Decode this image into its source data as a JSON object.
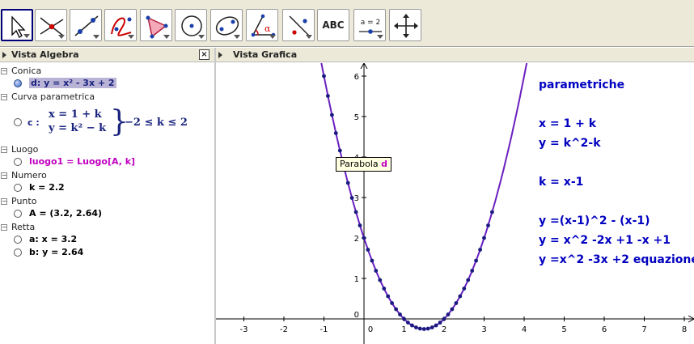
{
  "toolbar": {
    "tools": [
      {
        "name": "move-tool",
        "icon": "pointer-arrow-icon",
        "selected": true
      },
      {
        "name": "point-tool",
        "icon": "point-intersection-icon"
      },
      {
        "name": "line-tool",
        "icon": "line-through-points-icon"
      },
      {
        "name": "curve-tool",
        "icon": "curve-icon"
      },
      {
        "name": "polygon-tool",
        "icon": "polygon-icon"
      },
      {
        "name": "circle-tool",
        "icon": "circle-center-point-icon"
      },
      {
        "name": "conic-tool",
        "icon": "ellipse-icon"
      },
      {
        "name": "angle-tool",
        "icon": "angle-icon"
      },
      {
        "name": "reflect-tool",
        "icon": "reflect-line-icon"
      },
      {
        "name": "text-tool",
        "icon": "text-icon",
        "label": "ABC"
      },
      {
        "name": "slider-tool",
        "icon": "slider-icon",
        "label": "a = 2"
      },
      {
        "name": "move-view-tool",
        "icon": "move-view-icon"
      }
    ]
  },
  "algebra": {
    "title": "Vista Algebra",
    "close_label": "×",
    "categories": {
      "conica": "Conica",
      "curva": "Curva parametrica",
      "luogo": "Luogo",
      "numero": "Numero",
      "punto": "Punto",
      "retta": "Retta"
    },
    "items": {
      "d": "d: y = x² - 3x + 2",
      "c_label": "c :",
      "c_eq1": "x = 1 + k",
      "c_eq2": "y = k² − k",
      "c_brace": "}",
      "c_range": "−2 ≤ k ≤ 2",
      "luogo1": "luogo1 = Luogo[A, k]",
      "k": "k = 2.2",
      "A": "A = (3.2, 2.64)",
      "a": "a: x = 3.2",
      "b": "b: y = 2.64"
    }
  },
  "graphics": {
    "title": "Vista Grafica",
    "tooltip_prefix": "Parabola",
    "tooltip_name": "d",
    "notes": [
      "parametriche",
      "x = 1 + k",
      "y = k^2-k",
      "k = x-1",
      "y =(x-1)^2 - (x-1)",
      "y = x^2 -2x +1 -x +1",
      "y =x^2 -3x +2 equazione"
    ],
    "x_ticks": [
      "-3",
      "-2",
      "-1",
      "0",
      "1",
      "2",
      "3",
      "4",
      "5",
      "6",
      "7",
      "8"
    ],
    "y_ticks": [
      "0",
      "1",
      "2",
      "3",
      "4",
      "5",
      "6"
    ],
    "curve_color": "#6a1fc0",
    "locus_color": "#1a1a80",
    "notes_color": "#0000c0"
  },
  "chart_data": {
    "type": "line",
    "x_range": [
      -3.3,
      8.2
    ],
    "y_range": [
      -0.4,
      6.4
    ],
    "series": [
      {
        "name": "d",
        "function": "y = x^2 - 3x + 2"
      }
    ],
    "locus": {
      "name": "luogo1",
      "x_range": [
        -1,
        3.2
      ],
      "step": 0.1
    }
  }
}
